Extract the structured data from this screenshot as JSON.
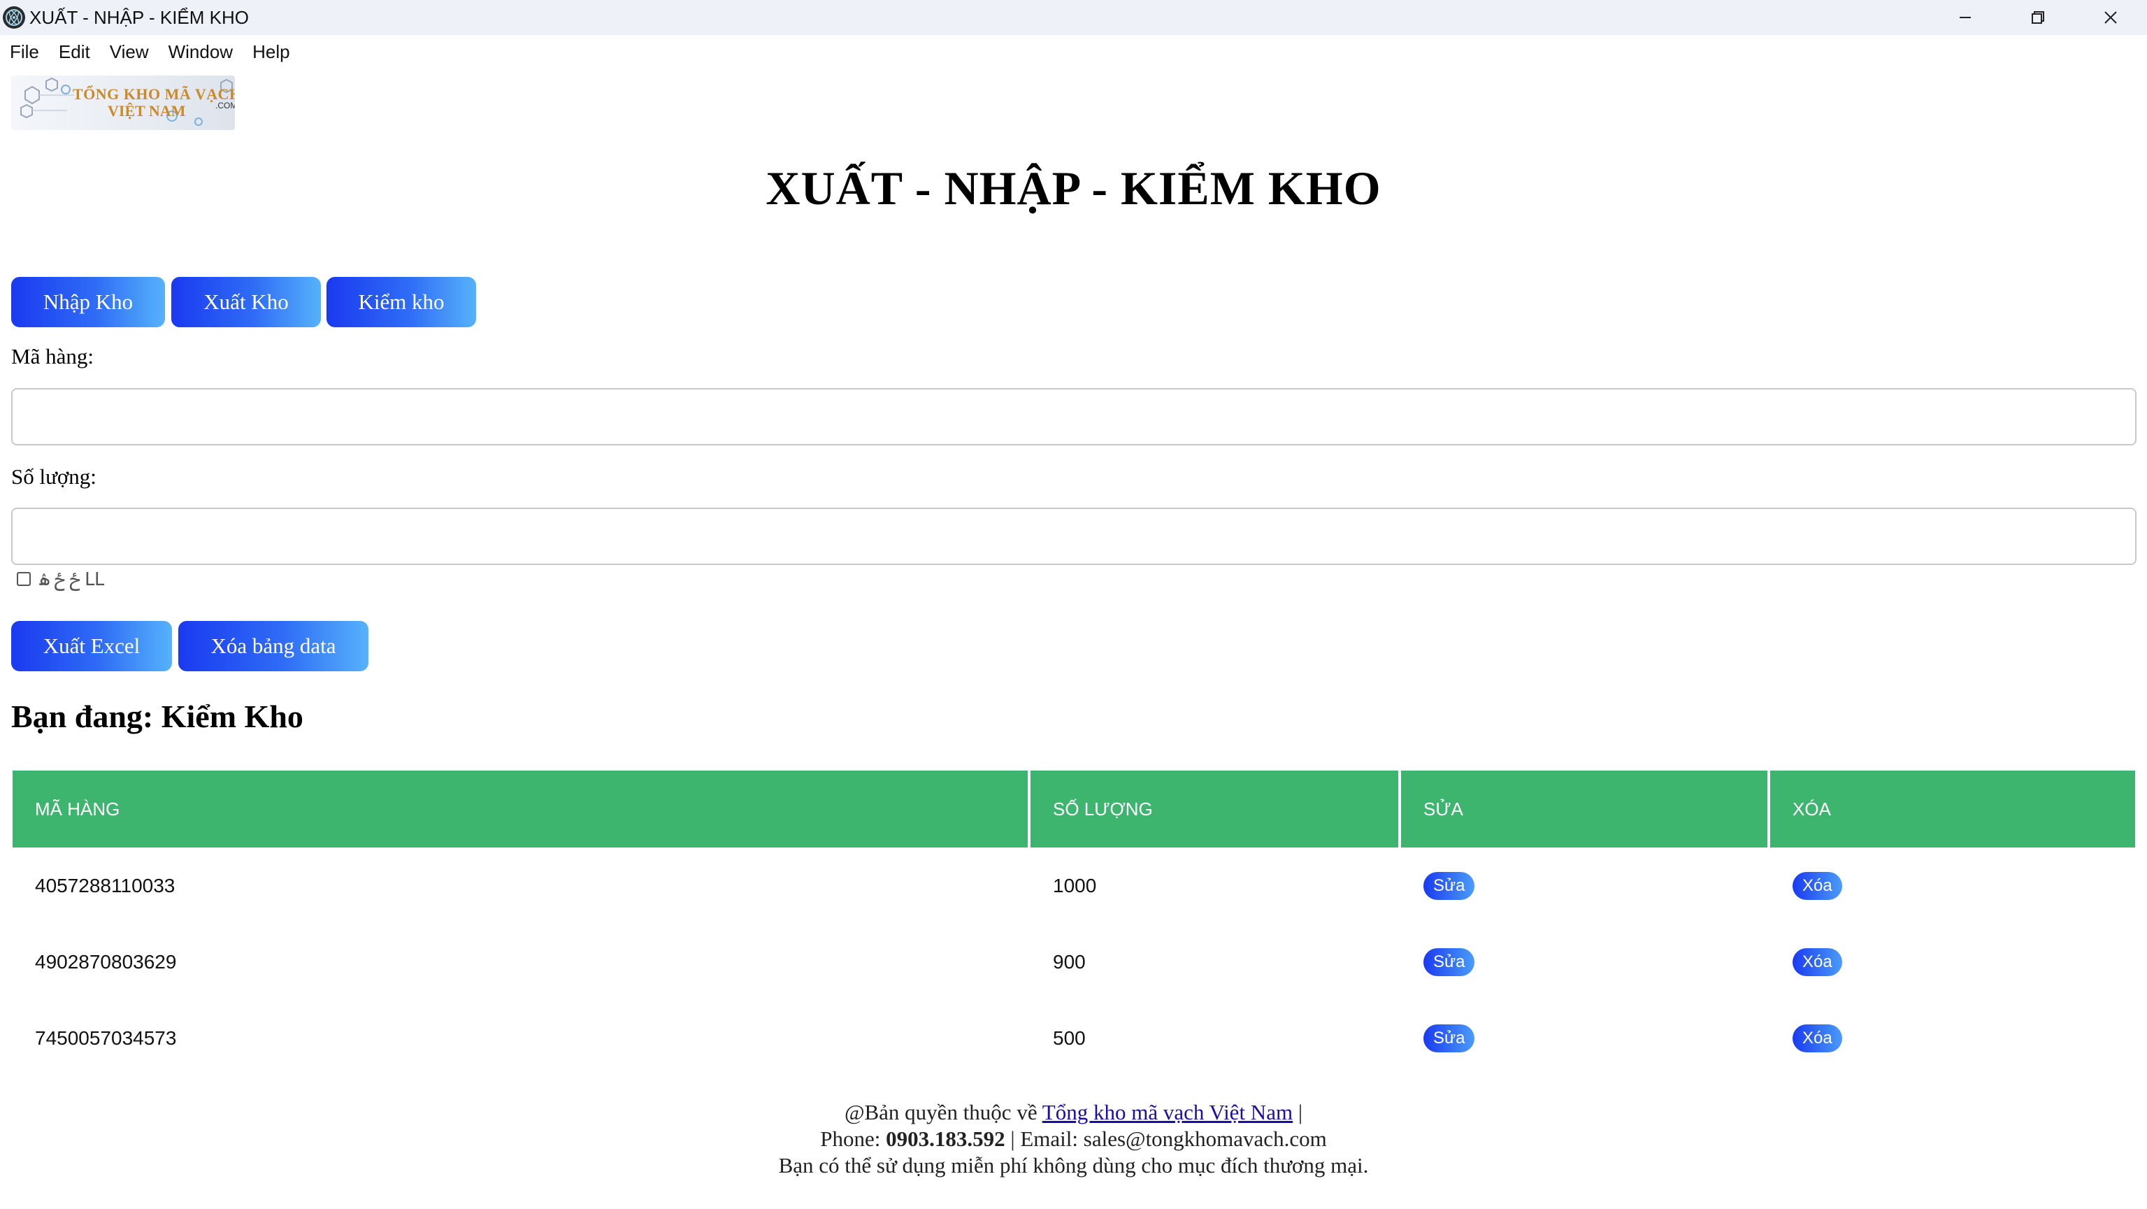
{
  "window": {
    "title": "XUẤT - NHẬP - KIỂM KHO",
    "controls": [
      "minimize-icon",
      "restore-icon",
      "close-icon"
    ]
  },
  "menu": [
    "File",
    "Edit",
    "View",
    "Window",
    "Help"
  ],
  "logo": {
    "line1": "TỔNG KHO MÃ VẠCH",
    "line2": "VIỆT NAM",
    "suffix": ".COM"
  },
  "page": {
    "title": "XUẤT - NHẬP - KIỂM KHO"
  },
  "tabs": [
    "Nhập Kho",
    "Xuất Kho",
    "Kiểm kho"
  ],
  "form": {
    "code_label": "Mã hàng:",
    "code_value": "",
    "qty_label": "Số lượng:",
    "qty_value": "",
    "checkbox_label": "ځ ځ ۿ ԼԼ"
  },
  "actions": {
    "export_label": "Xuất Excel",
    "clear_label": "Xóa bảng data"
  },
  "status": "Bạn đang: Kiểm Kho",
  "table": {
    "headers": [
      "MÃ HÀNG",
      "SỐ LƯỢNG",
      "SỬA",
      "XÓA"
    ],
    "rows": [
      {
        "code": "4057288110033",
        "qty": "1000",
        "edit": "Sửa",
        "delete": "Xóa"
      },
      {
        "code": "4902870803629",
        "qty": "900",
        "edit": "Sửa",
        "delete": "Xóa"
      },
      {
        "code": "7450057034573",
        "qty": "500",
        "edit": "Sửa",
        "delete": "Xóa"
      }
    ]
  },
  "footer": {
    "copyright_prefix": "@Bản quyền thuộc về",
    "link_text": "Tổng kho mã vạch Việt Nam",
    "separator": "|",
    "phone_label": "Phone:",
    "phone": "0903.183.592",
    "email_text": "| Email: sales@tongkhomavach.com",
    "note": "Bạn có thể sử dụng miễn phí không dùng cho mục đích thương mại."
  },
  "colors": {
    "accent_start": "#1a3af0",
    "accent_end": "#56b2fb",
    "table_header": "#3db56f"
  }
}
